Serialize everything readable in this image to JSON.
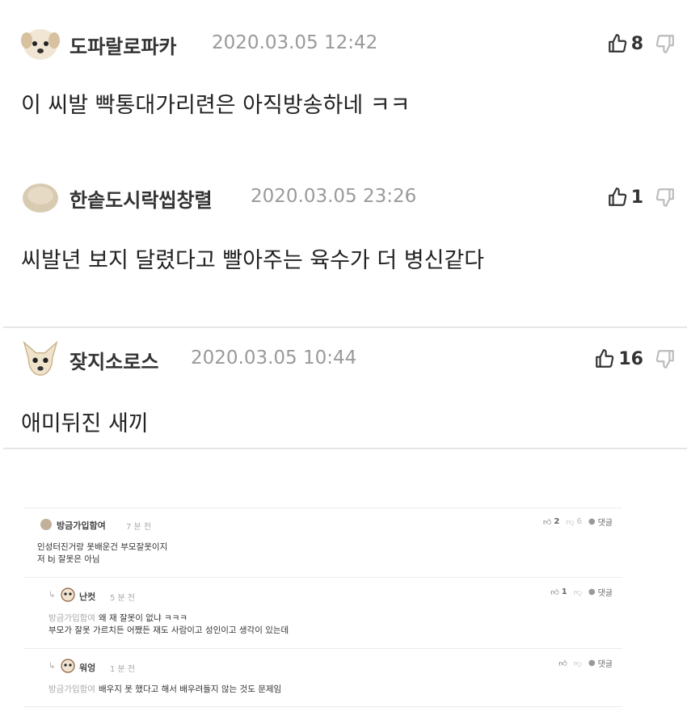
{
  "comments": [
    {
      "author": "도파랄로파카",
      "date": "2020.03.05 12:42",
      "likes": "8",
      "body": "이 씨발 빡통대가리련은 아직방송하네 ㅋㅋ",
      "avatar": "puppy-avatar"
    },
    {
      "author": "한솥도시락씹창렬",
      "date": "2020.03.05 23:26",
      "likes": "1",
      "body": "씨발년 보지 달렸다고 빨아주는 육수가 더 병신같다",
      "avatar": "rice-ball-avatar"
    },
    {
      "author": "잦지소로스",
      "date": "2020.03.05 10:44",
      "likes": "16",
      "body": "애미뒤진 새끼",
      "avatar": "chihuahua-avatar"
    }
  ],
  "thread": {
    "main": {
      "author": "방금가입함여",
      "time": "7 분 전",
      "likes": "2",
      "dislikes": "6",
      "reply_label": "댓글",
      "lines": [
        "인성터진거랑 못배운건 부모잘못이지",
        "저 bj 잘못은 아님"
      ]
    },
    "replies": [
      {
        "author": "난컷",
        "time": "5 분 전",
        "likes": "1",
        "reply_label": "댓글",
        "mention": "방금가입함여",
        "lines": [
          "왜 재 잘못이 없냐 ㅋㅋㅋ",
          "부모가 잘못 가르치든 어쨌든 재도 사람이고 성인이고 생각이 있는데"
        ]
      },
      {
        "author": "워엉",
        "time": "1 분 전",
        "likes": "",
        "reply_label": "댓글",
        "mention": "방금가입함여",
        "lines": [
          "배우지 못 했다고 해서 배우려들지 않는 것도 문제임"
        ]
      }
    ]
  },
  "colors": {
    "text": "#222222",
    "muted": "#9a9a9a",
    "divider": "#e6e6e6"
  }
}
